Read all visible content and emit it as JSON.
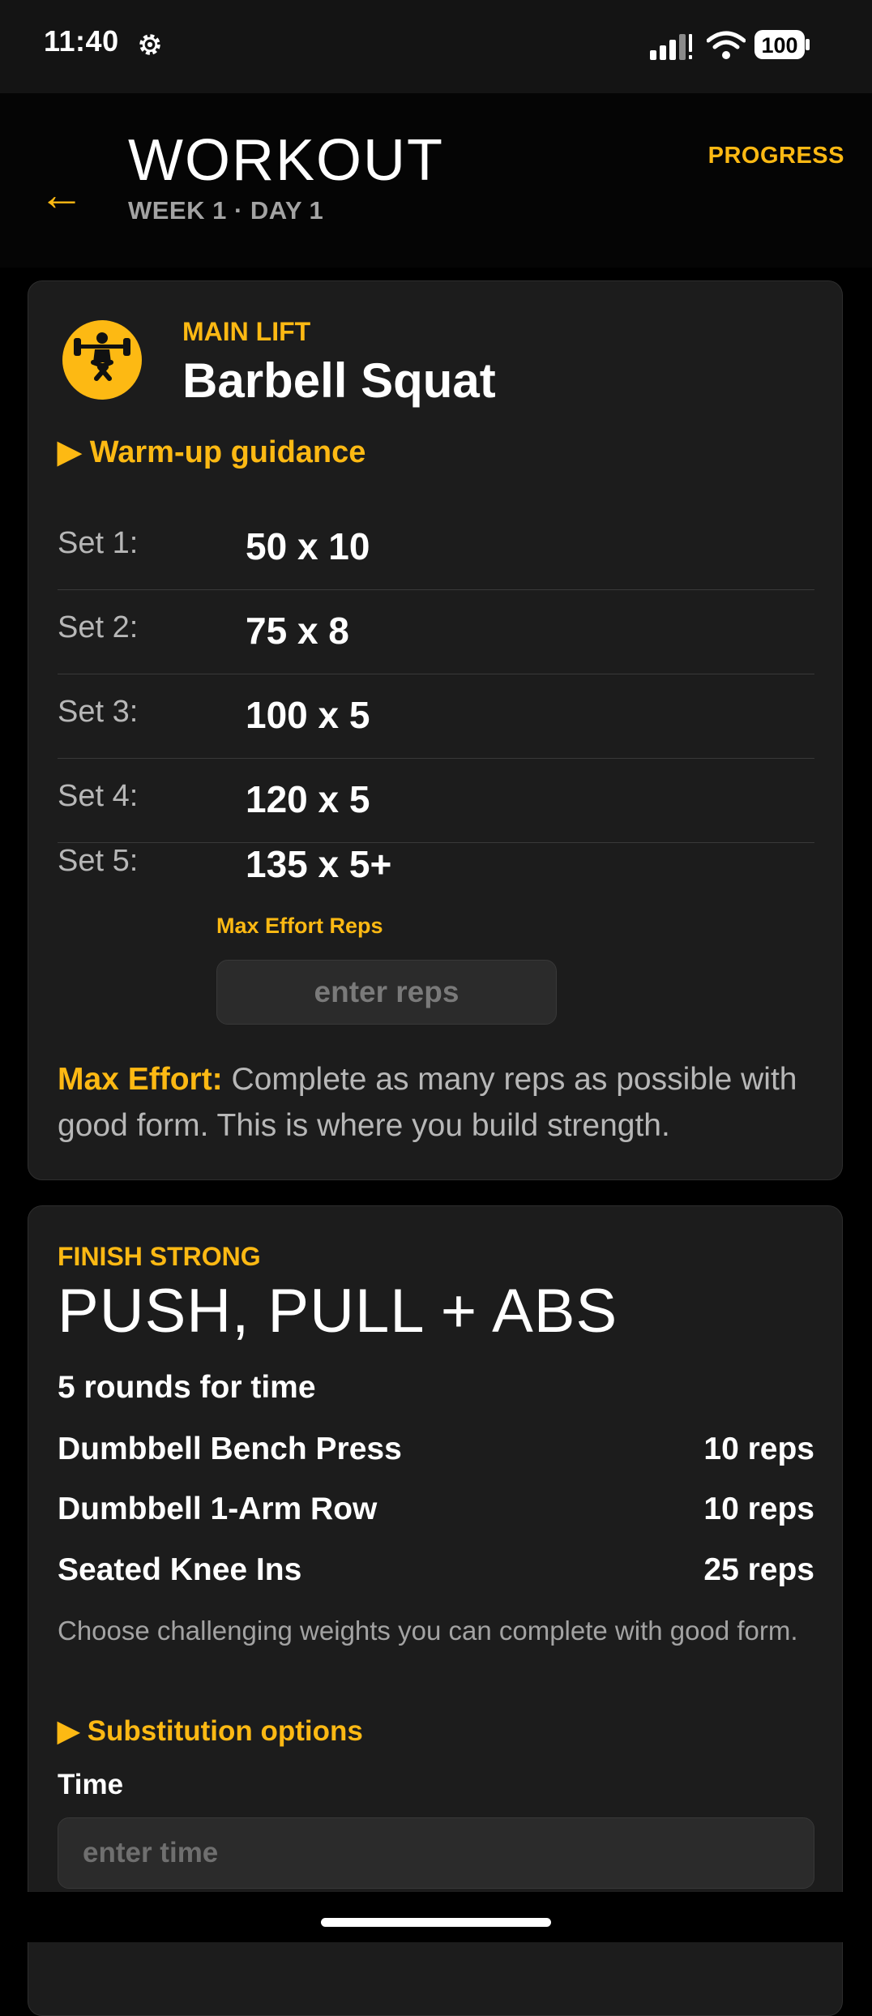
{
  "status_bar": {
    "time": "11:40",
    "battery": "100",
    "icons": [
      "gear-icon",
      "signal-icon",
      "wifi-icon",
      "battery-icon"
    ]
  },
  "header": {
    "back_icon": "arrow-left-icon",
    "back_glyph": "←",
    "title": "WORKOUT",
    "subtitle": "WEEK 1 · DAY 1",
    "progress_label": "PROGRESS"
  },
  "main_lift": {
    "icon": "barbell-squat-icon",
    "label": "MAIN LIFT",
    "name": "Barbell Squat",
    "warmup_label": "▶ Warm-up guidance",
    "sets": [
      {
        "label": "Set 1:",
        "value": "50 x 10"
      },
      {
        "label": "Set 2:",
        "value": "75 x 8"
      },
      {
        "label": "Set 3:",
        "value": "100 x 5"
      },
      {
        "label": "Set 4:",
        "value": "120 x 5"
      },
      {
        "label": "Set 5:",
        "value": "135 x 5+"
      }
    ],
    "max_reps_label": "Max Effort Reps",
    "reps_placeholder": "enter reps",
    "max_effort_title": "Max Effort:",
    "max_effort_text": " Complete as many reps as possible with good form. This is where you build strength."
  },
  "finish": {
    "label": "FINISH STRONG",
    "title": "PUSH, PULL + ABS",
    "rounds": "5 rounds for time",
    "exercises": [
      {
        "name": "Dumbbell Bench Press",
        "reps": "10 reps"
      },
      {
        "name": "Dumbbell 1-Arm Row",
        "reps": "10 reps"
      },
      {
        "name": "Seated Knee Ins",
        "reps": "25 reps"
      }
    ],
    "note": "Choose challenging weights you can complete with good form.",
    "substitution_label": "▶ Substitution options",
    "time_label": "Time",
    "time_placeholder": "enter time"
  },
  "colors": {
    "accent": "#fdb913",
    "background": "#000000",
    "card": "#1c1c1c",
    "muted": "#a3a3a3"
  }
}
